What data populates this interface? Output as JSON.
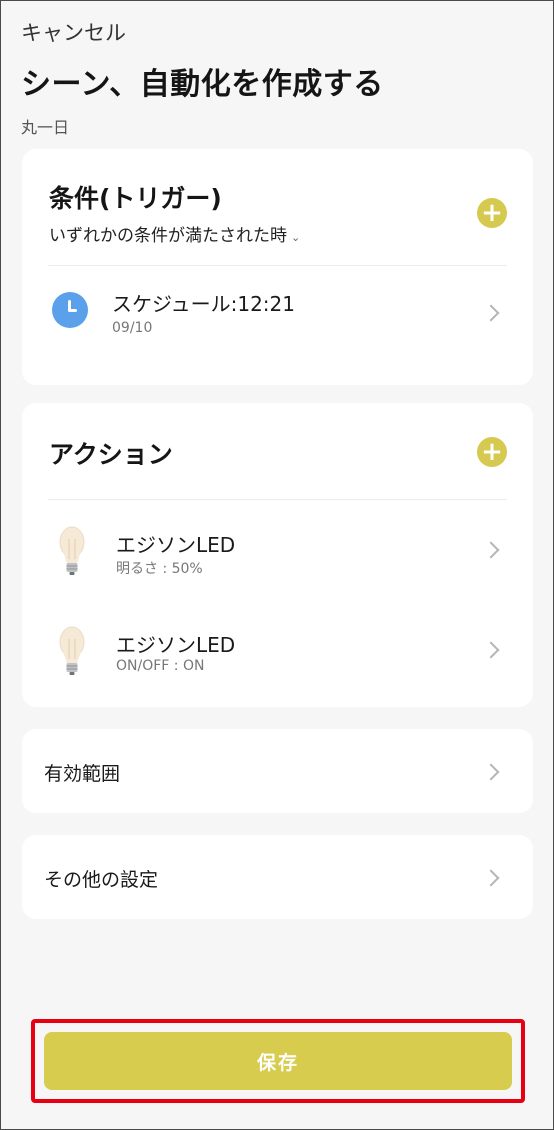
{
  "header": {
    "cancel_label": "キャンセル",
    "title": "シーン、自動化を作成する",
    "subtitle": "丸一日"
  },
  "trigger": {
    "title": "条件(トリガー)",
    "mode": "いずれかの条件が満たされた時",
    "mode_caret": "⌄",
    "items": [
      {
        "title": "スケジュール:12:21",
        "sub": "09/10",
        "icon": "clock-icon"
      }
    ]
  },
  "action": {
    "title": "アクション",
    "items": [
      {
        "title": "エジソンLED",
        "sub": "明るさ : 50%",
        "icon": "light-bulb-icon"
      },
      {
        "title": "エジソンLED",
        "sub": "ON/OFF : ON",
        "icon": "light-bulb-icon"
      }
    ]
  },
  "scope": {
    "label": "有効範囲"
  },
  "other": {
    "label": "その他の設定"
  },
  "save": {
    "label": "保存"
  },
  "colors": {
    "accent": "#d8cc4e",
    "highlight_border": "#e60012",
    "clock_blue": "#5aa0ea"
  }
}
